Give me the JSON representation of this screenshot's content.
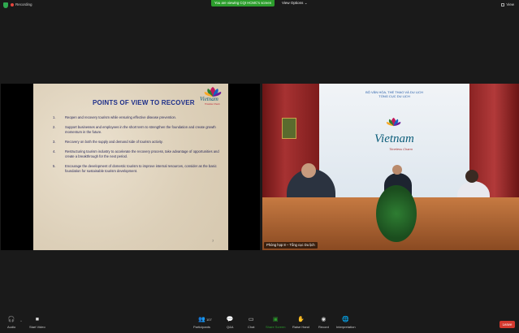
{
  "topbar": {
    "recording_label": "Recording",
    "viewing_text": "You are viewing CQI HCMC's screen",
    "view_options_label": "View Options",
    "view_label": "View"
  },
  "slide": {
    "title": "POINTS OF VIEW TO RECOVER",
    "logo_word": "Vietnam",
    "logo_tagline": "Timeless Charm",
    "points": [
      {
        "num": "1.",
        "text": "Reopen and recovery tourism while ensuring effective disease prevention."
      },
      {
        "num": "2.",
        "text": "Support businesses and employees in the short term to strengthen the foundation and create growth momentum in the future."
      },
      {
        "num": "3.",
        "text": "Recovery on both the supply and demand side of tourism activity."
      },
      {
        "num": "4.",
        "text": "Restructuring tourism industry to accelerate the recovery process, take advantage of opportunities and create a breakthrough for the next period."
      },
      {
        "num": "5.",
        "text": "Encourage the development of domestic tourism to improve internal resources, consider as the basic foundation for sustainable tourism development."
      }
    ],
    "page_number": "7"
  },
  "video": {
    "wall_sign_line1": "BỘ VĂN HÓA, THỂ THAO VÀ DU LỊCH",
    "wall_sign_line2": "TỔNG CỤC DU LỊCH",
    "brand_word": "Vietnam",
    "brand_tagline": "Timeless Charm",
    "participant_name": "Phòng họp 8 – Tổng cục Du lịch"
  },
  "toolbar": {
    "audio_label": "Audio",
    "video_label": "Start Video",
    "participants_label": "Participants",
    "participants_count": "107",
    "qa_label": "Q&A",
    "chat_label": "Chat",
    "share_label": "Share Screen",
    "raise_label": "Raise Hand",
    "record_label": "Record",
    "interp_label": "Interpretation",
    "leave_label": "Leave"
  },
  "colors": {
    "accent_green": "#2c9d2c",
    "leave_red": "#d4392f",
    "slide_title_blue": "#1e2f8a"
  }
}
